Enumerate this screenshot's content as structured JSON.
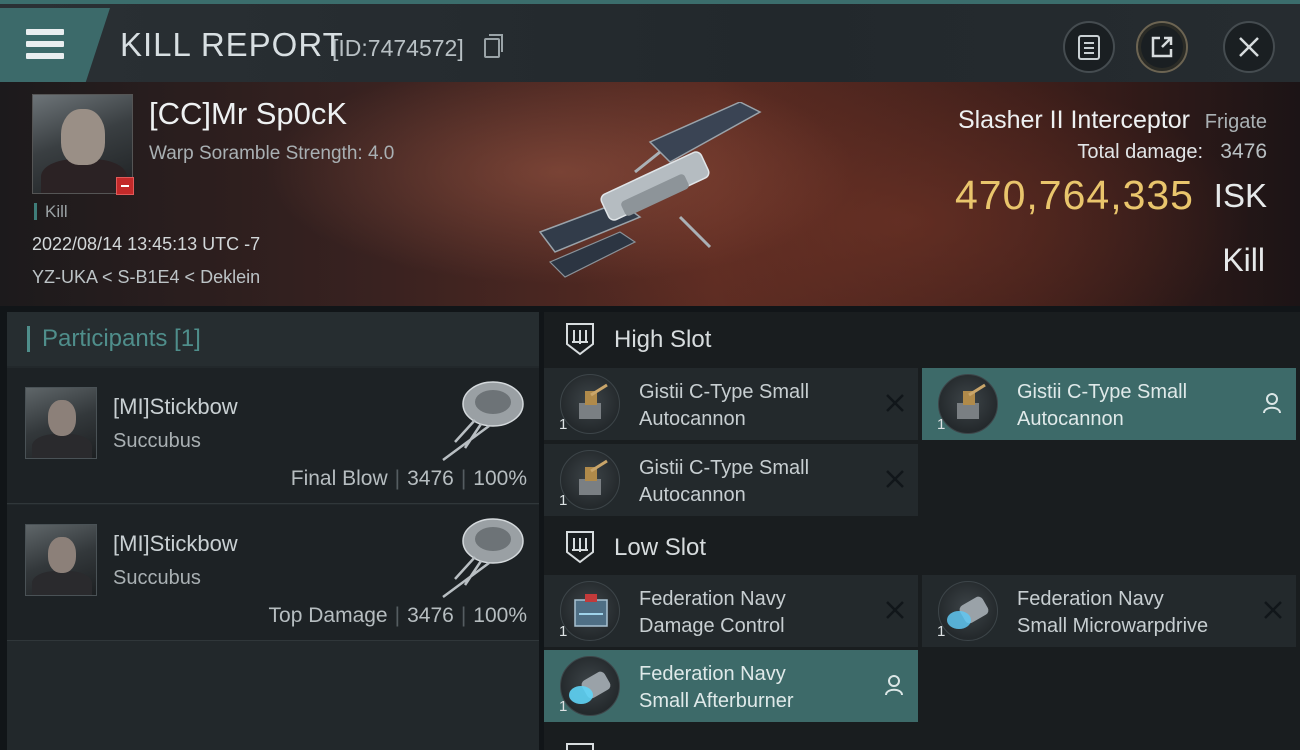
{
  "header": {
    "title": "KILL REPORT",
    "report_id": "[ID:7474572]"
  },
  "victim": {
    "name": "[CC]Mr Sp0cK",
    "scramble": "Warp Soramble Strength: 4.0",
    "tag": "Kill",
    "datetime": "2022/08/14 13:45:13 UTC -7",
    "location": "YZ-UKA < S-B1E4 < Deklein"
  },
  "ship": {
    "name": "Slasher II Interceptor",
    "class": "Frigate",
    "damage_label": "Total damage:",
    "damage_value": "3476",
    "isk_value": "470,764,335",
    "isk_unit": "ISK",
    "kill_type": "Kill"
  },
  "participants": {
    "title": "Participants [1]",
    "items": [
      {
        "name": "[MI]Stickbow",
        "ship": "Succubus",
        "role": "Final Blow",
        "damage": "3476",
        "percent": "100%"
      },
      {
        "name": "[MI]Stickbow",
        "ship": "Succubus",
        "role": "Top Damage",
        "damage": "3476",
        "percent": "100%"
      }
    ]
  },
  "fitting": {
    "high_slot": {
      "title": "High Slot",
      "modules": [
        {
          "qty": "1",
          "name_line1": "Gistii C-Type Small",
          "name_line2": "Autocannon",
          "state": "destroyed"
        },
        {
          "qty": "1",
          "name_line1": "Gistii C-Type Small",
          "name_line2": "Autocannon",
          "state": "dropped"
        },
        {
          "qty": "1",
          "name_line1": "Gistii C-Type Small",
          "name_line2": "Autocannon",
          "state": "destroyed"
        }
      ]
    },
    "low_slot": {
      "title": "Low Slot",
      "modules": [
        {
          "qty": "1",
          "name_line1": "Federation Navy",
          "name_line2": "Damage Control",
          "state": "destroyed"
        },
        {
          "qty": "1",
          "name_line1": "Federation Navy",
          "name_line2": "Small Microwarpdrive",
          "state": "destroyed"
        },
        {
          "qty": "1",
          "name_line1": "Federation Navy",
          "name_line2": "Small Afterburner",
          "state": "dropped"
        }
      ]
    }
  },
  "colors": {
    "accent_teal": "#3d6a69",
    "isk_gold": "#e9c56c",
    "loss_red": "#c32a2a"
  },
  "icons": [
    "menu-icon",
    "copy-icon",
    "clipboard-icon",
    "share-icon",
    "close-icon",
    "slot-icon",
    "destroyed-x-icon",
    "dropped-user-icon"
  ]
}
